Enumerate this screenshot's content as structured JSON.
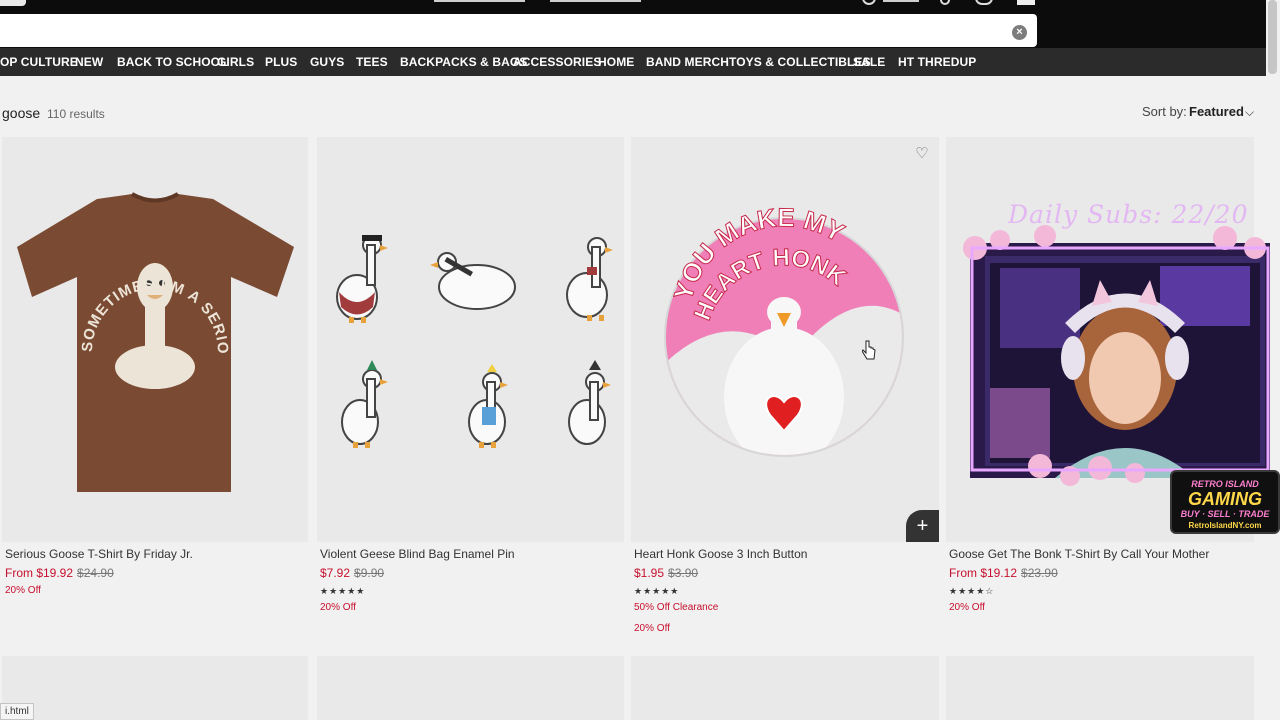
{
  "search": {
    "value": "",
    "clear_icon": "close-circle-icon"
  },
  "nav": [
    "OP CULTURE",
    "NEW",
    "BACK TO SCHOOL",
    "GIRLS",
    "PLUS",
    "GUYS",
    "TEES",
    "BACKPACKS & BAGS",
    "ACCESSORIES",
    "HOME",
    "BAND MERCH",
    "TOYS & COLLECTIBLES",
    "SALE",
    "HT THREDUP"
  ],
  "results": {
    "query": "goose",
    "count": "110 results"
  },
  "sort": {
    "label": "Sort by:",
    "value": "Featured",
    "icon": "chevron-down-icon"
  },
  "products": [
    {
      "title": "Serious Goose T-Shirt By Friday Jr.",
      "price": "From $19.92",
      "original": "$24.90",
      "rating": "",
      "badges": [
        "20% Off"
      ],
      "shirt_text": "SOMETIMES I'M A SERIOUS GOOSE"
    },
    {
      "title": "Violent Geese Blind Bag Enamel Pin",
      "price": "$7.92",
      "original": "$9.90",
      "rating": "★★★★★",
      "badges": [
        "20% Off"
      ]
    },
    {
      "title": "Heart Honk Goose 3 Inch Button",
      "price": "$1.95",
      "original": "$3.90",
      "rating": "★★★★★",
      "badges": [
        "50% Off Clearance",
        "20% Off"
      ],
      "button_text_1": "YOU MAKE MY",
      "button_text_2": "HEART HONK"
    },
    {
      "title": "Goose Get The Bonk T-Shirt By Call Your Mother",
      "price": "From $19.12",
      "original": "$23.90",
      "rating": "★★★★☆",
      "badges": [
        "20% Off"
      ]
    }
  ],
  "overlay": {
    "subs_text": "Daily Subs: 22/20",
    "sponsor_line1": "RETRO ISLAND",
    "sponsor_line2": "GAMING",
    "sponsor_line3": "BUY · SELL · TRADE",
    "sponsor_line4": "RetroIslandNY.com"
  },
  "status_bar": {
    "url": "i.html"
  },
  "colors": {
    "sale_red": "#c8102e",
    "nav_bg": "#2b2b2b",
    "topbar_bg": "#0c0c0c",
    "button_pink": "#f07fb8"
  }
}
